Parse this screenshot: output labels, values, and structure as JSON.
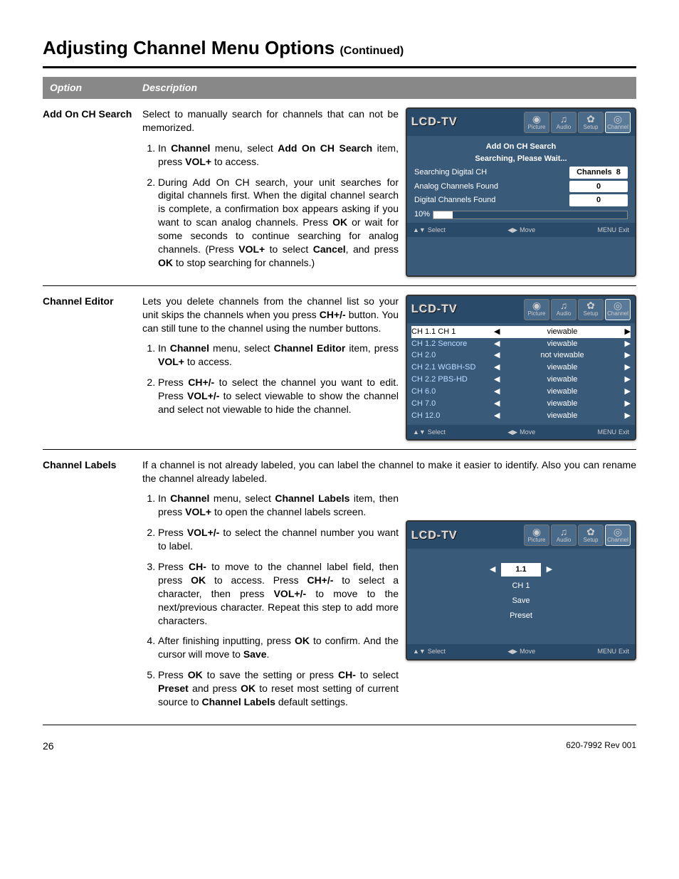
{
  "title": "Adjusting Channel Menu Options",
  "continued": "(Continued)",
  "headers": {
    "option": "Option",
    "description": "Description"
  },
  "sections": {
    "addOn": {
      "name": "Add On CH Search",
      "intro": "Select to manually search for channels that can not be memorized.",
      "step1_a": "In ",
      "step1_b": "Channel",
      "step1_c": " menu, select ",
      "step1_d": "Add On CH Search",
      "step1_e": " item, press ",
      "step1_f": "VOL+",
      "step1_g": " to access.",
      "step2_a": "During Add On CH search, your unit searches for digital channels first. When the digital channel search is complete, a confirmation box appears asking if you want to scan analog channels. Press ",
      "step2_b": "OK",
      "step2_c": " or wait for some seconds to continue searching for analog channels. (Press ",
      "step2_d": "VOL+",
      "step2_e": " to select ",
      "step2_f": "Cancel",
      "step2_g": ", and press ",
      "step2_h": "OK",
      "step2_i": " to stop searching for channels.)"
    },
    "editor": {
      "name": "Channel Editor",
      "intro_a": "Lets you delete channels from the channel list so your unit skips the channels when you press ",
      "intro_b": "CH+/-",
      "intro_c": " button. You can still tune to the channel using the number buttons.",
      "step1_a": "In ",
      "step1_b": "Channel",
      "step1_c": " menu, select ",
      "step1_d": "Channel Editor",
      "step1_e": " item, press ",
      "step1_f": "VOL+",
      "step1_g": " to access.",
      "step2_a": "Press ",
      "step2_b": "CH+/-",
      "step2_c": " to select the channel you want to edit.  Press ",
      "step2_d": "VOL+/-",
      "step2_e": " to select viewable to show the channel and select not viewable to hide the channel."
    },
    "labels": {
      "name": "Channel Labels",
      "intro": "If a channel is not already labeled, you can label the channel to make it easier to identify. Also you can rename the channel already labeled.",
      "step1_a": "In ",
      "step1_b": "Channel",
      "step1_c": " menu, select ",
      "step1_d": "Channel Labels",
      "step1_e": " item, then press ",
      "step1_f": "VOL+",
      "step1_g": " to open the channel labels screen.",
      "step2_a": "Press ",
      "step2_b": "VOL+/-",
      "step2_c": " to select the channel number you want to label.",
      "step3_a": "Press ",
      "step3_b": "CH-",
      "step3_c": " to move to the channel label field, then press ",
      "step3_d": "OK",
      "step3_e": " to access. Press ",
      "step3_f": "CH+/-",
      "step3_g": " to select a character, then press ",
      "step3_h": "VOL+/-",
      "step3_i": " to move to the next/previous character. Repeat this step to add more characters.",
      "step4_a": "After finishing inputting, press ",
      "step4_b": "OK",
      "step4_c": " to confirm. And the cursor will move to ",
      "step4_d": "Save",
      "step4_e": ".",
      "step5_a": "Press ",
      "step5_b": "OK",
      "step5_c": " to save the setting or press ",
      "step5_d": "CH-",
      "step5_e": " to select ",
      "step5_f": "Preset",
      "step5_g": " and press ",
      "step5_h": "OK",
      "step5_i": " to reset most setting of current source to ",
      "step5_j": "Channel Labels",
      "step5_k": " default settings."
    }
  },
  "tv": {
    "logo": "LCD-TV",
    "tabs": {
      "picture": "Picture",
      "audio": "Audio",
      "setup": "Setup",
      "channel": "Channel"
    },
    "footer": {
      "select": "Select",
      "move": "Move",
      "menu": "MENU",
      "exit": "Exit"
    },
    "addOn": {
      "title": "Add On CH Search",
      "subtitle": "Searching, Please Wait...",
      "searching": "Searching Digital CH",
      "channelsLabel": "Channels",
      "channelsVal": "8",
      "analog": "Analog Channels Found",
      "analogVal": "0",
      "digital": "Digital Channels Found",
      "digitalVal": "0",
      "percent": "10%"
    },
    "editor": {
      "rows": [
        {
          "n": "CH 1.1 CH 1",
          "s": "viewable"
        },
        {
          "n": "CH 1.2 Sencore",
          "s": "viewable"
        },
        {
          "n": "CH 2.0",
          "s": "not viewable"
        },
        {
          "n": "CH 2.1 WGBH-SD",
          "s": "viewable"
        },
        {
          "n": "CH 2.2 PBS-HD",
          "s": "viewable"
        },
        {
          "n": "CH 6.0",
          "s": "viewable"
        },
        {
          "n": "CH 7.0",
          "s": "viewable"
        },
        {
          "n": "CH 12.0",
          "s": "viewable"
        }
      ]
    },
    "labels": {
      "num": "1.1",
      "ch": "CH 1",
      "save": "Save",
      "preset": "Preset"
    }
  },
  "footer": {
    "page": "26",
    "rev": "620-7992 Rev 001"
  }
}
